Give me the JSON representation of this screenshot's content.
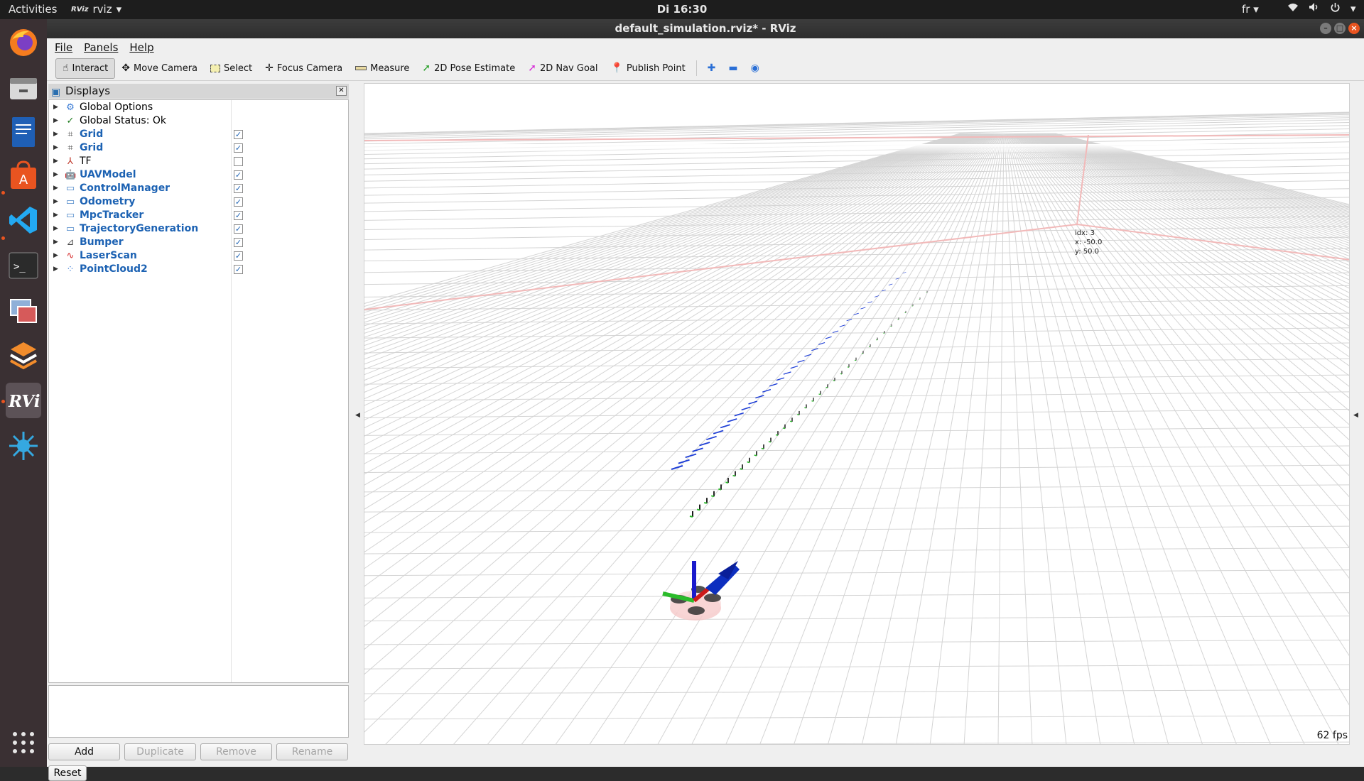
{
  "topbar": {
    "activities": "Activities",
    "app_name": "rviz",
    "clock": "Di 16:30",
    "lang": "fr"
  },
  "window": {
    "title": "default_simulation.rviz* - RViz"
  },
  "menu": [
    "File",
    "Panels",
    "Help"
  ],
  "toolbar": {
    "tools": [
      {
        "name": "interact",
        "label": "Interact",
        "icon": "hand-icon",
        "active": true
      },
      {
        "name": "move-camera",
        "label": "Move Camera",
        "icon": "move-icon"
      },
      {
        "name": "select",
        "label": "Select",
        "icon": "select-box-icon"
      },
      {
        "name": "focus-camera",
        "label": "Focus Camera",
        "icon": "focus-icon"
      },
      {
        "name": "measure",
        "label": "Measure",
        "icon": "ruler-icon"
      },
      {
        "name": "2d-pose-estimate",
        "label": "2D Pose Estimate",
        "icon": "green-arrow-icon"
      },
      {
        "name": "2d-nav-goal",
        "label": "2D Nav Goal",
        "icon": "pink-arrow-icon"
      },
      {
        "name": "publish-point",
        "label": "Publish Point",
        "icon": "pin-icon"
      }
    ]
  },
  "displays": {
    "title": "Displays",
    "items": [
      {
        "label": "Global Options",
        "icon": "gear-icon",
        "style": "plain"
      },
      {
        "label": "Global Status: Ok",
        "icon": "check-icon",
        "style": "plain"
      },
      {
        "label": "Grid",
        "icon": "grid-icon",
        "style": "blue",
        "checked": true
      },
      {
        "label": "Grid",
        "icon": "grid-icon",
        "style": "blue",
        "checked": true
      },
      {
        "label": "TF",
        "icon": "axes-icon",
        "style": "plain",
        "checked": false
      },
      {
        "label": "UAVModel",
        "icon": "robot-icon",
        "style": "blue",
        "checked": true
      },
      {
        "label": "ControlManager",
        "icon": "folder-icon",
        "style": "blue",
        "checked": true
      },
      {
        "label": "Odometry",
        "icon": "folder-icon",
        "style": "blue",
        "checked": true
      },
      {
        "label": "MpcTracker",
        "icon": "folder-icon",
        "style": "blue",
        "checked": true
      },
      {
        "label": "TrajectoryGeneration",
        "icon": "folder-icon",
        "style": "blue",
        "checked": true
      },
      {
        "label": "Bumper",
        "icon": "range-icon",
        "style": "blue",
        "checked": true
      },
      {
        "label": "LaserScan",
        "icon": "laser-icon",
        "style": "blue",
        "checked": true
      },
      {
        "label": "PointCloud2",
        "icon": "cloud-icon",
        "style": "blue",
        "checked": true
      }
    ],
    "buttons": {
      "add": "Add",
      "duplicate": "Duplicate",
      "remove": "Remove",
      "rename": "Rename"
    },
    "reset": "Reset"
  },
  "viewport": {
    "annotation": {
      "idx": "idx:   3",
      "x": "x:   -50.0",
      "y": "y:   50.0"
    },
    "fps": "62 fps"
  },
  "colors": {
    "accent": "#e95420",
    "tree_blue": "#1c62b3"
  }
}
